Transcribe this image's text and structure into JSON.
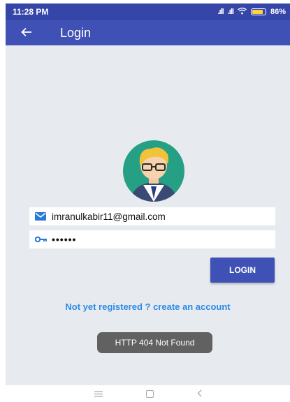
{
  "status_bar": {
    "time": "11:28 PM",
    "battery_percent": "86%",
    "battery_level": 0.86
  },
  "app_bar": {
    "title": "Login",
    "back_icon": "arrow-back-icon"
  },
  "form": {
    "email_icon": "mail-icon",
    "email_value": "imranulkabir11@gmail.com",
    "password_icon": "key-icon",
    "password_value": "••••••",
    "login_label": "LOGIN"
  },
  "register_link": "Not yet registered ? create an account",
  "toast": "HTTP 404 Not Found",
  "colors": {
    "primary": "#3f51b5",
    "status_bar": "#3546a8",
    "content_bg": "#e7ebef",
    "link": "#2d8ae8",
    "toast_bg": "#616161",
    "avatar_circle": "#26a085"
  }
}
